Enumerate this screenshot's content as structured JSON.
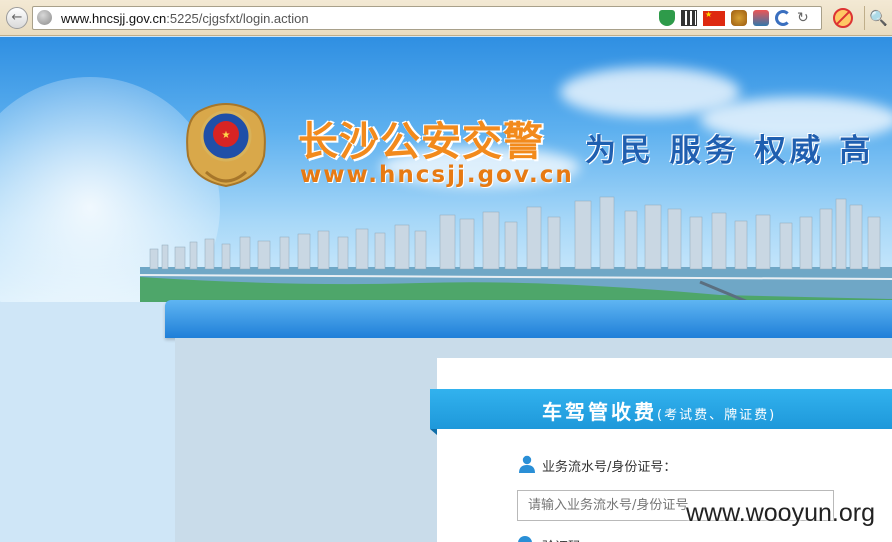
{
  "browser": {
    "url_host": "www.hncsjj.gov.cn",
    "url_path": ":5225/cjgsfxt/login.action",
    "icons": [
      "back-icon",
      "globe-icon",
      "shield-icon",
      "qr-code-icon",
      "china-flag-icon",
      "dragon-icon",
      "java-icon",
      "moon-icon",
      "reload-icon",
      "block-icon",
      "search-icon"
    ]
  },
  "banner": {
    "title": "长沙公安交警",
    "url": "www.hncsjj.gov.cn",
    "slogan": "为民 服务 权威 高"
  },
  "panel": {
    "title": "车驾管收费",
    "subtitle": "(考试费、牌证费)",
    "field_label": "业务流水号/身份证号：",
    "field_placeholder": "请输入业务流水号/身份证号",
    "second_label": "验证码"
  },
  "watermark": "www.wooyun.org",
  "colors": {
    "accent_blue": "#1e98da",
    "title_orange": "#f28a1c",
    "slogan_blue": "#1f5fb0"
  }
}
